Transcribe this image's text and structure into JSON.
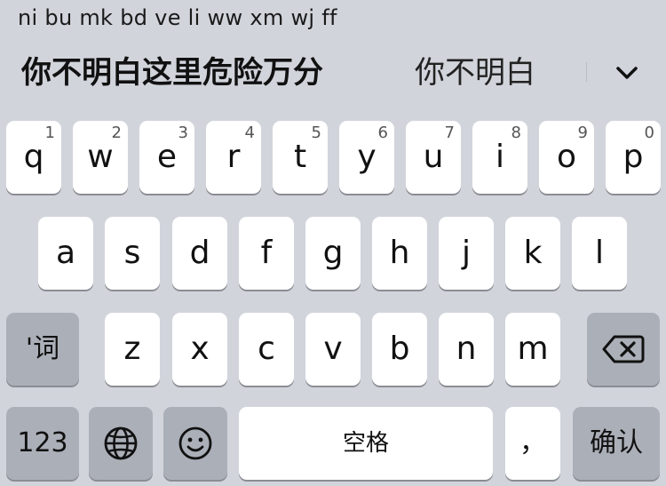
{
  "composition": {
    "pinyin": "ni bu mk bd ve li ww xm wj ff"
  },
  "candidates": {
    "items": [
      "你不明白这里危险万分",
      "你不明白"
    ]
  },
  "keyboard": {
    "row1": [
      {
        "label": "q",
        "hint": "1"
      },
      {
        "label": "w",
        "hint": "2"
      },
      {
        "label": "e",
        "hint": "3"
      },
      {
        "label": "r",
        "hint": "4"
      },
      {
        "label": "t",
        "hint": "5"
      },
      {
        "label": "y",
        "hint": "6"
      },
      {
        "label": "u",
        "hint": "7"
      },
      {
        "label": "i",
        "hint": "8"
      },
      {
        "label": "o",
        "hint": "9"
      },
      {
        "label": "p",
        "hint": "0"
      }
    ],
    "row2": [
      "a",
      "s",
      "d",
      "f",
      "g",
      "h",
      "j",
      "k",
      "l"
    ],
    "row3": [
      "z",
      "x",
      "c",
      "v",
      "b",
      "n",
      "m"
    ],
    "separator_label": "'词",
    "numbers_label": "123",
    "space_label": "空格",
    "comma_label": "，",
    "confirm_label": "确认",
    "icons": {
      "expand": "chevron-down-icon",
      "delete": "backspace-icon",
      "globe": "globe-icon",
      "emoji": "emoji-icon"
    }
  }
}
